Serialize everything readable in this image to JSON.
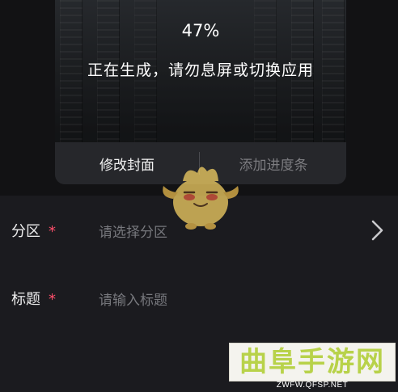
{
  "preview": {
    "progress_text": "47%",
    "progress_fraction": 0.47,
    "message": "正在生成，请勿息屏或切换应用",
    "buttons": {
      "edit_cover": "修改封面",
      "add_progress_bar": "添加进度条"
    }
  },
  "form": {
    "section": {
      "label": "分区",
      "required_mark": "*",
      "placeholder": "请选择分区"
    },
    "title": {
      "label": "标题",
      "required_mark": "*",
      "placeholder": "请输入标题"
    }
  },
  "icons": {
    "chevron": "chevron-right-icon",
    "mascot": "mascot-icon"
  },
  "watermark": {
    "brand": "曲阜手游网",
    "url": "ZWFW.QFSP.NET"
  },
  "colors": {
    "required": "#ff4f6b",
    "background": "#1b1b1f",
    "watermark_text": "#b8d24a"
  }
}
